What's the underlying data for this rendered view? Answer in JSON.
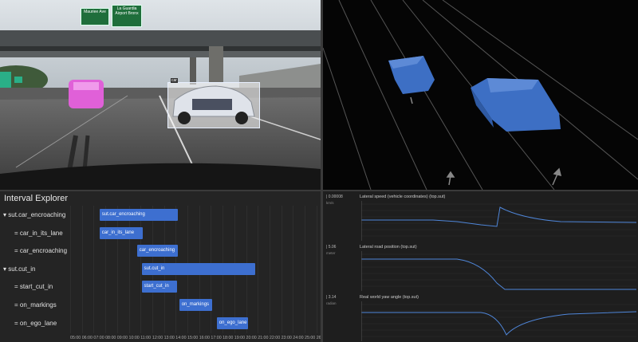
{
  "camera": {
    "sign_left": "Mauriee Ave",
    "sign_right": "La Guardia Airport Bronx",
    "bbox_label": "car"
  },
  "explorer": {
    "title": "Interval Explorer",
    "rows": [
      {
        "label": "▾ sut.car_encroaching",
        "bar": "sut.car_encroaching",
        "start": 7.5,
        "end": 14.2
      },
      {
        "label": "= car_in_its_lane",
        "bar": "car_in_its_lane",
        "start": 7.5,
        "end": 11.2
      },
      {
        "label": "= car_encroaching",
        "bar": "car_encroaching",
        "start": 10.7,
        "end": 14.2
      },
      {
        "label": "▾ sut.cut_in",
        "bar": "sut.cut_in",
        "start": 11.1,
        "end": 20.8
      },
      {
        "label": "=   start_cut_in",
        "bar": "start_cut_in",
        "start": 11.1,
        "end": 14.1
      },
      {
        "label": "= on_markings",
        "bar": "on_markings",
        "start": 14.3,
        "end": 17.1
      },
      {
        "label": "= on_ego_lane",
        "bar": "on_ego_lane",
        "start": 17.5,
        "end": 20.2
      }
    ],
    "ticks": [
      "05:00",
      "06:00",
      "07:00",
      "08:00",
      "09:00",
      "10:00",
      "11:00",
      "12:00",
      "13:00",
      "14:00",
      "15:00",
      "16:00",
      "17:00",
      "18:00",
      "19:00",
      "20:00",
      "21:00",
      "22:00",
      "23:00",
      "24:00",
      "25:00",
      "26:00"
    ]
  },
  "plots": [
    {
      "value": "| 0.00008",
      "unit": "km/s",
      "title": "Lateral speed (vehicle coordinates) (top.sut)"
    },
    {
      "value": "| 5.06",
      "unit": "meter",
      "title": "Lateral road position (top.sut)"
    },
    {
      "value": "| 3.14",
      "unit": "radian",
      "title": "Real world yaw angle (top.sut)"
    }
  ]
}
